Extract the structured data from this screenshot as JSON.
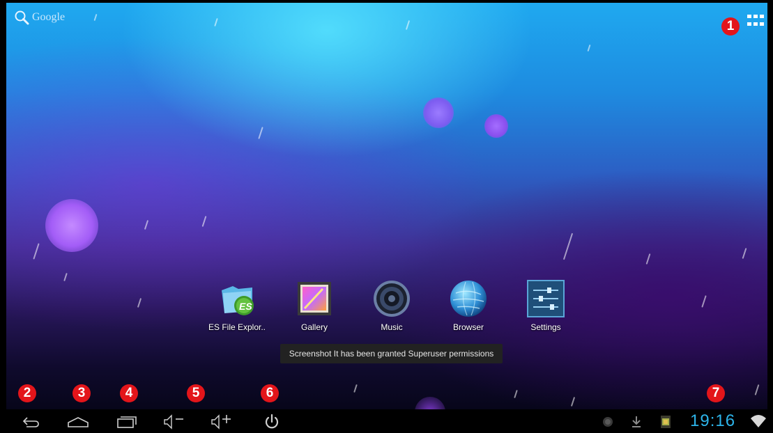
{
  "search": {
    "label": "Google",
    "icon": "search-icon"
  },
  "apps_button": {
    "icon": "all-apps-grid-icon"
  },
  "badges": [
    "1",
    "2",
    "3",
    "4",
    "5",
    "6",
    "7"
  ],
  "dock": [
    {
      "label": "ES File Explor..",
      "icon": "es-file-explorer-icon"
    },
    {
      "label": "Gallery",
      "icon": "gallery-icon"
    },
    {
      "label": "Music",
      "icon": "music-speaker-icon"
    },
    {
      "label": "Browser",
      "icon": "globe-icon"
    },
    {
      "label": "Settings",
      "icon": "sliders-settings-icon"
    }
  ],
  "toast": {
    "text": "Screenshot It has been granted Superuser permissions"
  },
  "navbar": {
    "buttons": [
      "back-icon",
      "home-icon",
      "recent-apps-icon",
      "volume-down-icon",
      "volume-up-icon",
      "power-icon"
    ]
  },
  "status": {
    "time": "19:16",
    "tray_icons": [
      "notification-dot-icon",
      "download-icon",
      "sd-card-icon",
      "wifi-icon"
    ],
    "accent_color": "#2db4e9"
  }
}
